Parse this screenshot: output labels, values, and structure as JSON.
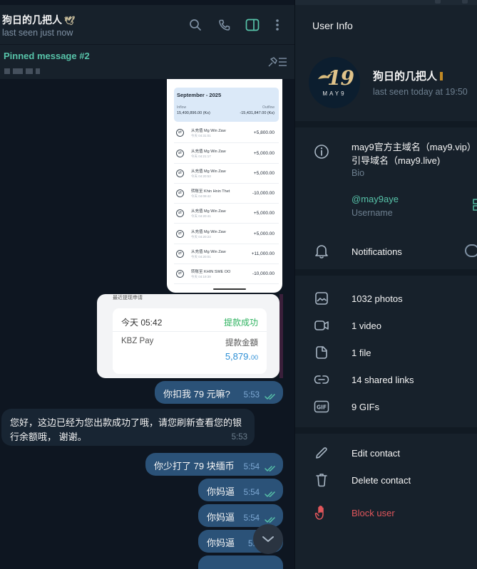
{
  "colors": {
    "accent": "#57c3a9",
    "outgoing_bubble": "#2b5278",
    "incoming_bubble": "#182533",
    "danger": "#e0565b",
    "success": "#2fb360",
    "amount_blue": "#2d8fd5"
  },
  "chat": {
    "title": "狗日的几把人",
    "status": "last seen just now",
    "header_icons": [
      "search-icon",
      "phone-icon",
      "sidebar-toggle-icon",
      "more-vertical-icon"
    ],
    "pinned": {
      "label": "Pinned message #2"
    },
    "screenshot1": {
      "month": "September - 2025",
      "inflow_label": "Inflow",
      "inflow_value": "15,490,896.00 (Ks)",
      "outflow_label": "Outflow",
      "outflow_value": "-15,431,847.00 (Ks)",
      "rows": [
        {
          "name": "从充值 Mg Win Zaw",
          "time": "今天 04:31:01",
          "amount": "+5,800.00"
        },
        {
          "name": "从充值 Mg Win Zaw",
          "time": "今天 04:21:17",
          "amount": "+5,000.00"
        },
        {
          "name": "从充值 Mg Win Zaw",
          "time": "今天 04:20:53",
          "amount": "+5,000.00"
        },
        {
          "name": "转账至 Khin Hnin Thet",
          "time": "今天 04:09:42",
          "amount": "-10,000.00"
        },
        {
          "name": "从充值 Mg Win Zaw",
          "time": "今天 04:20:41",
          "amount": "+5,000.00"
        },
        {
          "name": "从充值 Mg Win Zaw",
          "time": "今天 04:20:23",
          "amount": "+5,000.00"
        },
        {
          "name": "从充值 Mg Win Zaw",
          "time": "今天 04:20:01",
          "amount": "+11,000.00"
        },
        {
          "name": "转账至 KHIN SWE OO",
          "time": "今天 04:19:39",
          "amount": "-10,000.00"
        }
      ]
    },
    "screenshot2": {
      "top_text": "最近提现申请",
      "time": "今天 05:42",
      "status": "提款成功",
      "name": "KBZ Pay",
      "amount_label": "提款金額",
      "amount_main": "5,879.",
      "amount_cents": "00"
    },
    "messages": [
      {
        "text": "你扣我 79 元嘛?",
        "time": "5:53"
      },
      {
        "text": "您好，这边已经为您出款成功了哦，请您刷新查看您的银",
        "text2": "行余额哦，  谢谢。",
        "time": "5:53"
      },
      {
        "text": "你少打了 79 块缅币",
        "time": "5:54"
      },
      {
        "text": "你妈逼",
        "time": "5:54"
      },
      {
        "text": "你妈逼",
        "time": "5:54"
      },
      {
        "text": "你妈逼",
        "time": "5:5"
      }
    ]
  },
  "info": {
    "title": "User Info",
    "name": "狗日的几把人",
    "status": "last seen today at 19:50",
    "avatar_text": "19",
    "avatar_word": "MAY9",
    "bio_line1": "may9官方主域名（may9.vip）",
    "bio_line2": "引导域名（may9.live)",
    "bio_label": "Bio",
    "username": "@may9aye",
    "username_label": "Username",
    "notifications": "Notifications",
    "media": [
      {
        "icon": "photo-icon",
        "label": "1032 photos"
      },
      {
        "icon": "video-icon",
        "label": "1 video"
      },
      {
        "icon": "file-icon",
        "label": "1 file"
      },
      {
        "icon": "link-icon",
        "label": "14 shared links"
      },
      {
        "icon": "gif-icon",
        "label": "9 GIFs"
      }
    ],
    "edit_contact": "Edit contact",
    "delete_contact": "Delete contact",
    "block_user": "Block user"
  }
}
